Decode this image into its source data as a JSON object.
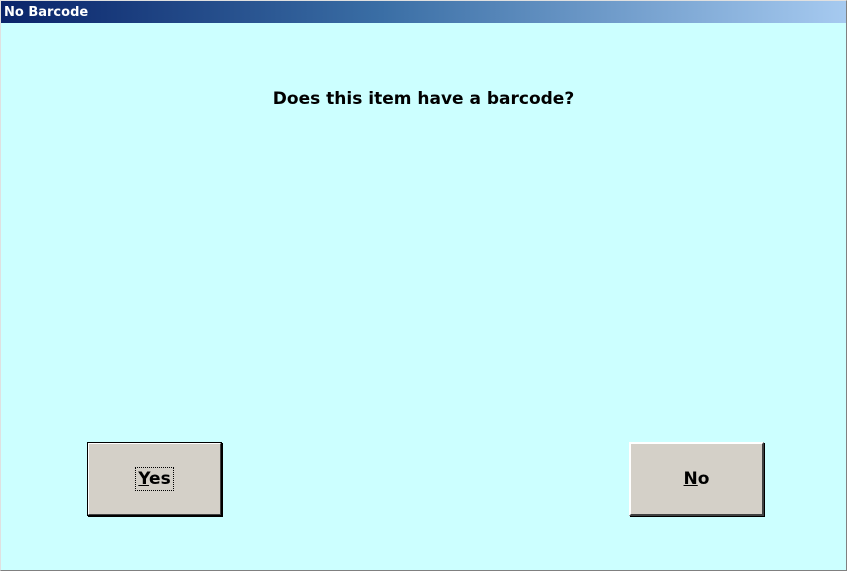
{
  "window": {
    "title": "No Barcode"
  },
  "dialog": {
    "question": "Does this item have a barcode?"
  },
  "buttons": {
    "yes": {
      "access_key": "Y",
      "rest": "es"
    },
    "no": {
      "access_key": "N",
      "rest": "o"
    }
  },
  "colors": {
    "background": "#ccffff",
    "titlebar_start": "#0a246a",
    "titlebar_end": "#a6caf0",
    "button_face": "#d4d0c8"
  }
}
